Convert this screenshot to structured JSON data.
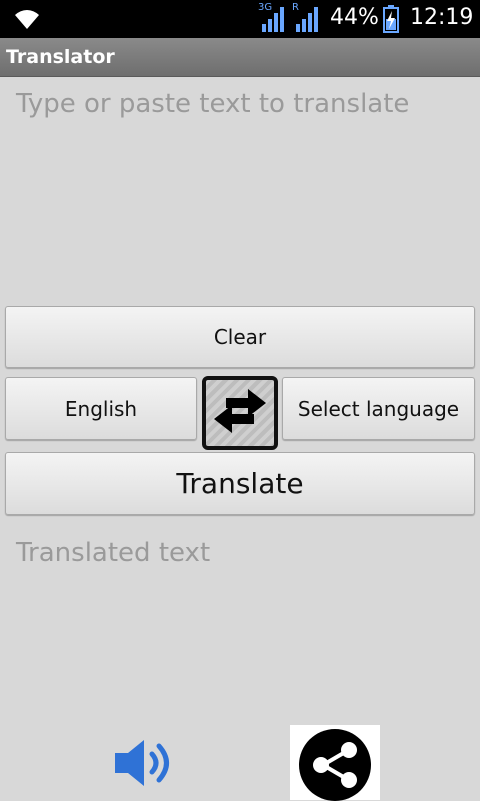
{
  "status_bar": {
    "network_3g": "3G",
    "network_r": "R",
    "battery_percent": "44%",
    "time": "12:19"
  },
  "app": {
    "title": "Translator"
  },
  "source_input": {
    "placeholder": "Type or paste text to translate",
    "value": ""
  },
  "buttons": {
    "clear": "Clear",
    "source_language": "English",
    "target_language": "Select language",
    "translate": "Translate"
  },
  "output": {
    "placeholder": "Translated text"
  },
  "icons": {
    "wifi": "wifi-icon",
    "signal": "signal-icon",
    "battery": "battery-icon",
    "swap": "swap-arrows-icon",
    "speaker": "speaker-icon",
    "share": "share-icon"
  },
  "colors": {
    "background": "#d8d8d8",
    "title_bar": "#7a7a7a",
    "speaker_blue": "#2f72d6",
    "status_blue": "#6aa7ff"
  }
}
